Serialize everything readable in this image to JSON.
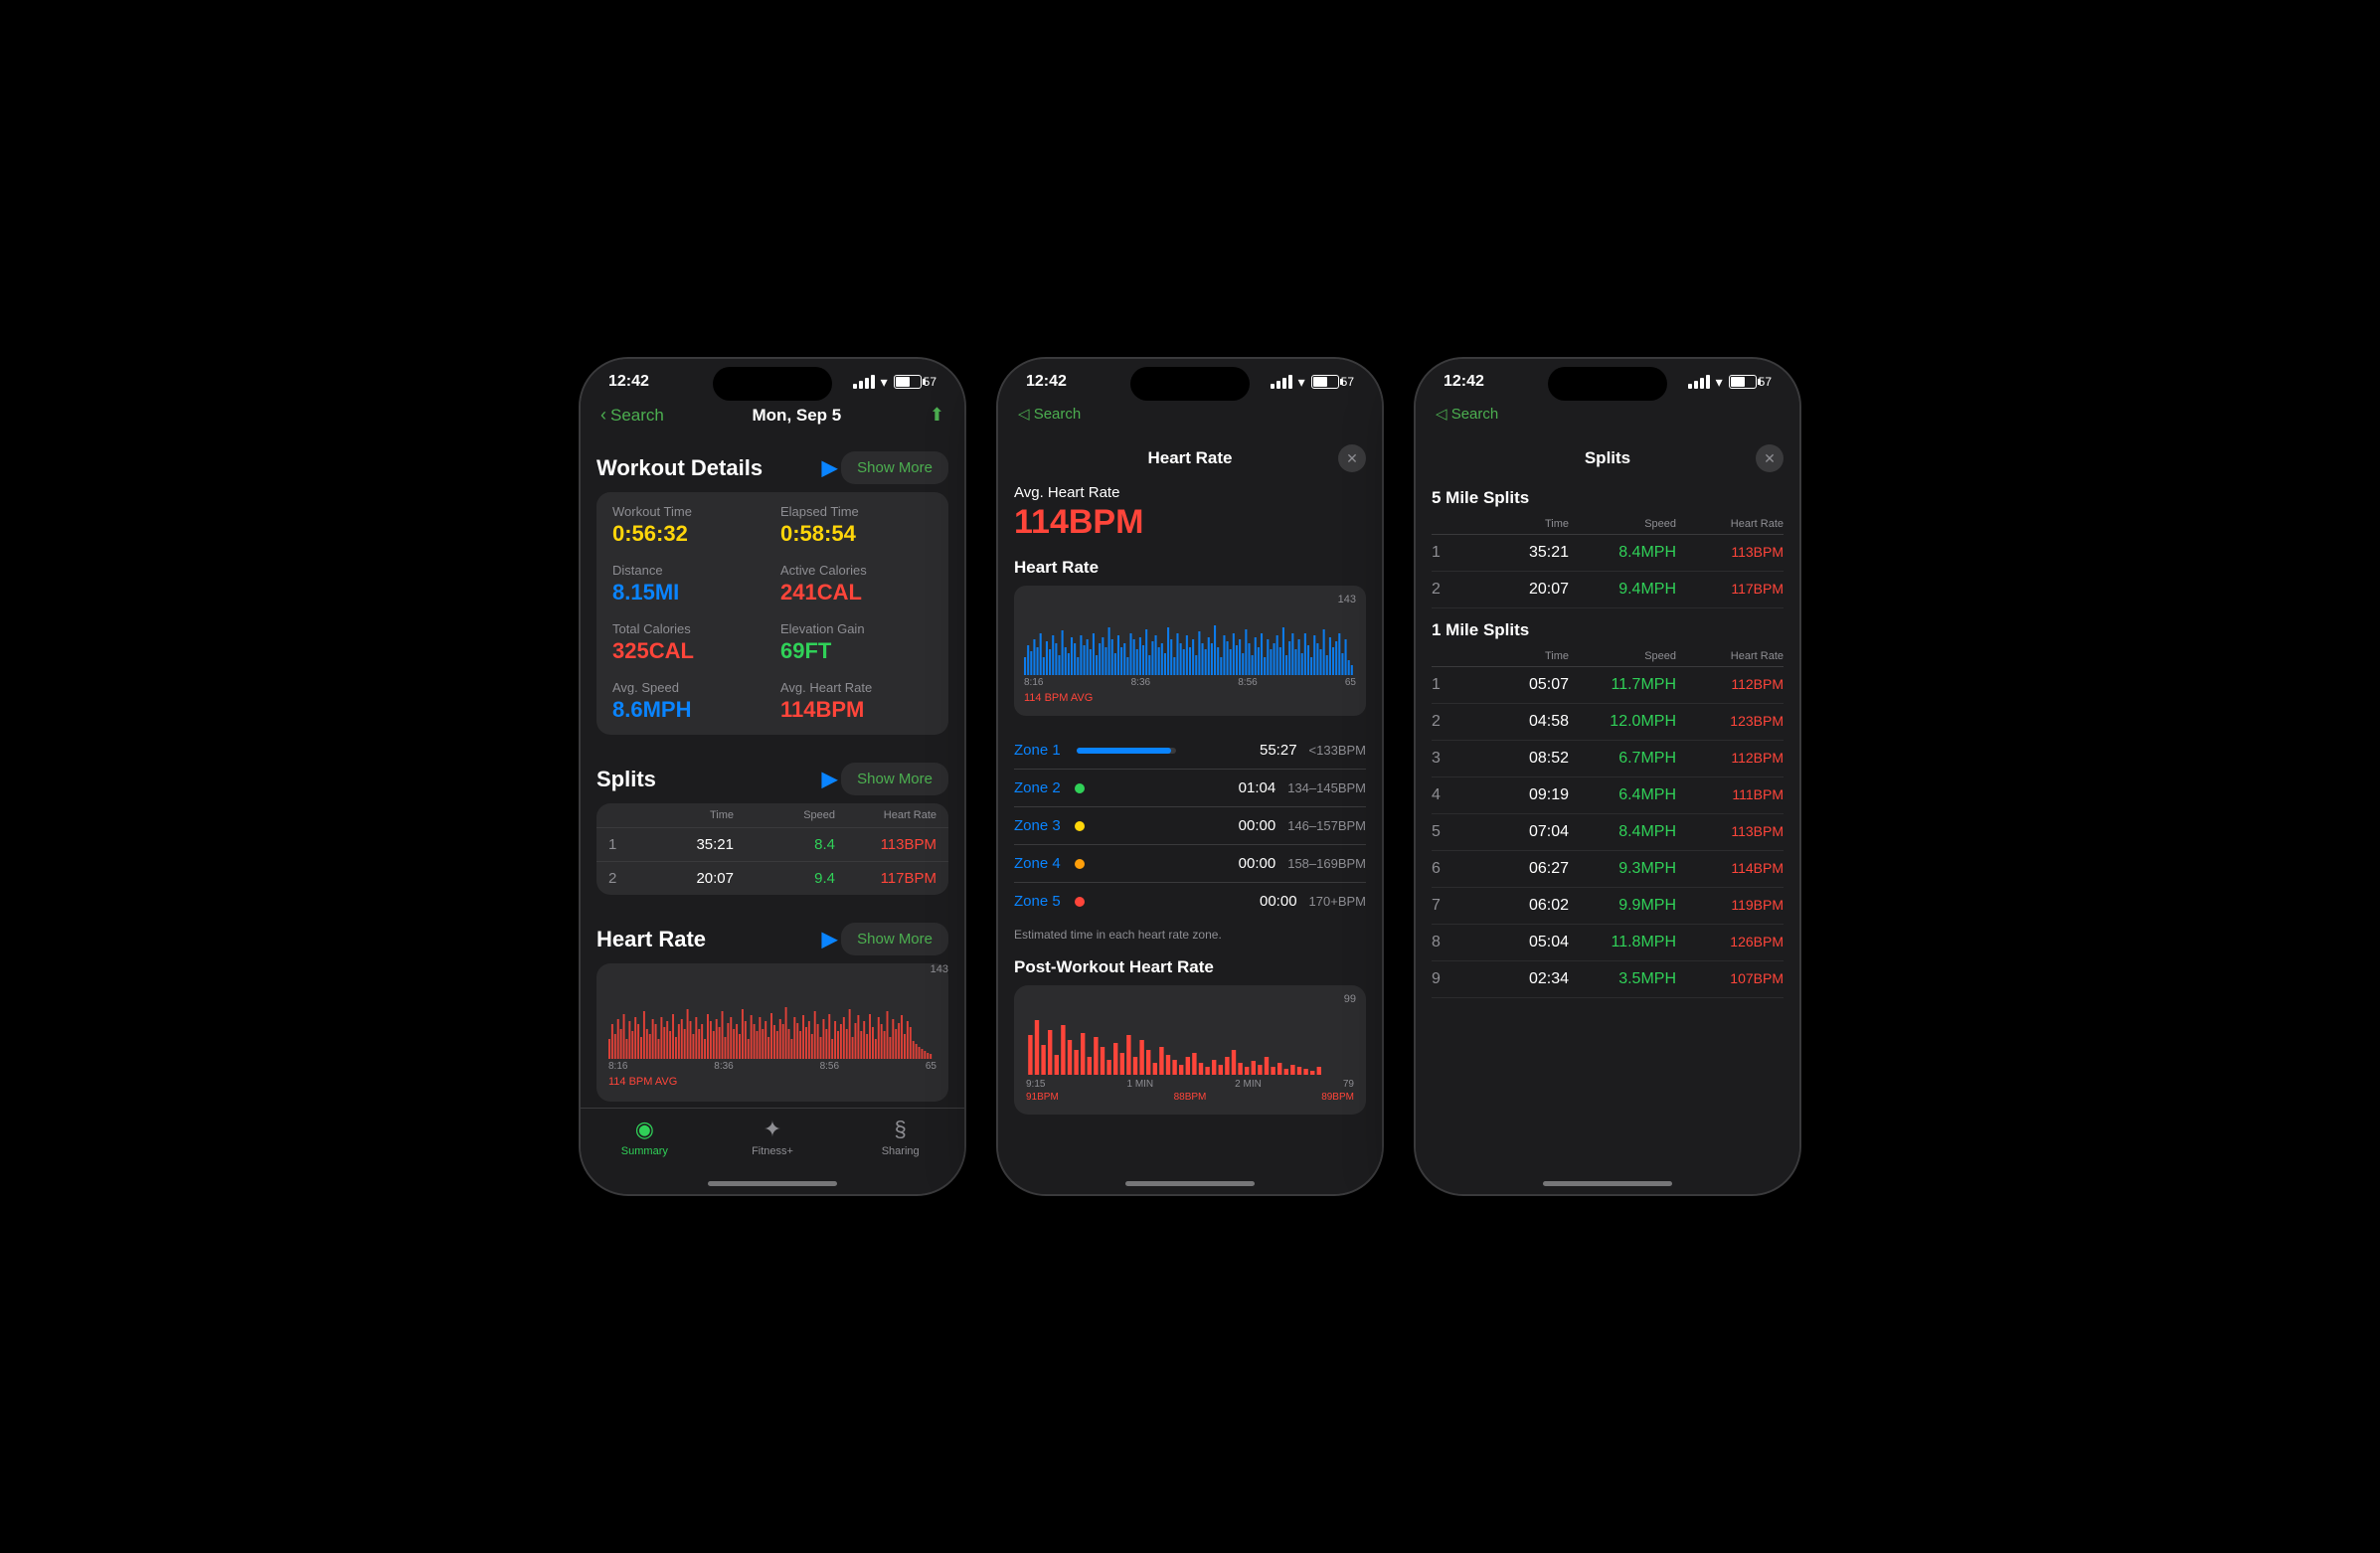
{
  "phones": {
    "phone1": {
      "status": {
        "time": "12:42",
        "battery": "57"
      },
      "nav": {
        "back_label": "Search",
        "title": "Mon, Sep 5",
        "back_chevron": "‹"
      },
      "workout_details": {
        "title": "Workout Details",
        "show_more": "Show More",
        "stats": [
          {
            "label": "Workout Time",
            "value": "0:56:32",
            "color": "yellow"
          },
          {
            "label": "Elapsed Time",
            "value": "0:58:54",
            "color": "yellow"
          },
          {
            "label": "Distance",
            "value": "8.15MI",
            "color": "blue"
          },
          {
            "label": "Active Calories",
            "value": "241CAL",
            "color": "red"
          },
          {
            "label": "Total Calories",
            "value": "325CAL",
            "color": "red"
          },
          {
            "label": "Elevation Gain",
            "value": "69FT",
            "color": "green"
          },
          {
            "label": "Avg. Speed",
            "value": "8.6MPH",
            "color": "blue"
          },
          {
            "label": "Avg. Heart Rate",
            "value": "114BPM",
            "color": "red"
          }
        ]
      },
      "splits": {
        "title": "Splits",
        "show_more": "Show More",
        "columns": [
          "",
          "Time",
          "Speed",
          "Heart Rate"
        ],
        "rows": [
          {
            "num": "1",
            "time": "35:21",
            "speed": "8.4",
            "hr": "113BPM"
          },
          {
            "num": "2",
            "time": "20:07",
            "speed": "9.4",
            "hr": "117BPM"
          }
        ]
      },
      "heart_rate": {
        "title": "Heart Rate",
        "show_more": "Show More",
        "top_label": "143",
        "bottom_label": "65",
        "time_labels": [
          "8:16",
          "8:36",
          "8:56"
        ],
        "avg_label": "114 BPM AVG"
      },
      "tabs": [
        {
          "icon": "◎",
          "label": "Summary",
          "active": true
        },
        {
          "icon": "✦",
          "label": "Fitness+",
          "active": false
        },
        {
          "icon": "$",
          "label": "Sharing",
          "active": false
        }
      ]
    },
    "phone2": {
      "status": {
        "time": "12:42",
        "battery": "57"
      },
      "nav": {
        "back_label": "Search"
      },
      "modal": {
        "title": "Heart Rate",
        "close": "✕",
        "avg_label": "Avg. Heart Rate",
        "avg_value": "114BPM",
        "hr_section": "Heart Rate",
        "top_label": "143",
        "bottom_label": "65",
        "time_labels": [
          "8:16",
          "8:36",
          "8:56"
        ],
        "avg_chart_label": "114 BPM AVG",
        "zones": [
          {
            "name": "Zone 1",
            "dot_color": "#0a84ff",
            "time": "55:27",
            "range": "<133BPM",
            "fill_pct": 95
          },
          {
            "name": "Zone 2",
            "dot_color": "#30d158",
            "time": "01:04",
            "range": "134–145BPM",
            "fill_pct": 5
          },
          {
            "name": "Zone 3",
            "dot_color": "#ffd60a",
            "time": "00:00",
            "range": "146–157BPM",
            "fill_pct": 0
          },
          {
            "name": "Zone 4",
            "dot_color": "#ff9f0a",
            "time": "00:00",
            "range": "158–169BPM",
            "fill_pct": 0
          },
          {
            "name": "Zone 5",
            "dot_color": "#ff453a",
            "time": "00:00",
            "range": "170+BPM",
            "fill_pct": 0
          }
        ],
        "zone_note": "Estimated time in each heart rate zone.",
        "post_title": "Post-Workout Heart Rate",
        "post_top": "99",
        "post_bottom": "79",
        "post_times": [
          "9:15",
          "1 MIN",
          "2 MIN"
        ],
        "post_labels": [
          "91BPM",
          "88BPM",
          "89BPM"
        ]
      }
    },
    "phone3": {
      "status": {
        "time": "12:42",
        "battery": "57"
      },
      "nav": {
        "back_label": "Search"
      },
      "modal": {
        "title": "Splits",
        "close": "✕",
        "five_mile": {
          "title": "5 Mile Splits",
          "columns": [
            "",
            "Time",
            "Speed",
            "Heart Rate"
          ],
          "rows": [
            {
              "num": "1",
              "time": "35:21",
              "speed": "8.4MPH",
              "hr": "113BPM"
            },
            {
              "num": "2",
              "time": "20:07",
              "speed": "9.4MPH",
              "hr": "117BPM"
            }
          ]
        },
        "one_mile": {
          "title": "1 Mile Splits",
          "columns": [
            "",
            "Time",
            "Speed",
            "Heart Rate"
          ],
          "rows": [
            {
              "num": "1",
              "time": "05:07",
              "speed": "11.7MPH",
              "hr": "112BPM"
            },
            {
              "num": "2",
              "time": "04:58",
              "speed": "12.0MPH",
              "hr": "123BPM"
            },
            {
              "num": "3",
              "time": "08:52",
              "speed": "6.7MPH",
              "hr": "112BPM"
            },
            {
              "num": "4",
              "time": "09:19",
              "speed": "6.4MPH",
              "hr": "111BPM"
            },
            {
              "num": "5",
              "time": "07:04",
              "speed": "8.4MPH",
              "hr": "113BPM"
            },
            {
              "num": "6",
              "time": "06:27",
              "speed": "9.3MPH",
              "hr": "114BPM"
            },
            {
              "num": "7",
              "time": "06:02",
              "speed": "9.9MPH",
              "hr": "119BPM"
            },
            {
              "num": "8",
              "time": "05:04",
              "speed": "11.8MPH",
              "hr": "126BPM"
            },
            {
              "num": "9",
              "time": "02:34",
              "speed": "3.5MPH",
              "hr": "107BPM"
            }
          ]
        }
      }
    }
  }
}
